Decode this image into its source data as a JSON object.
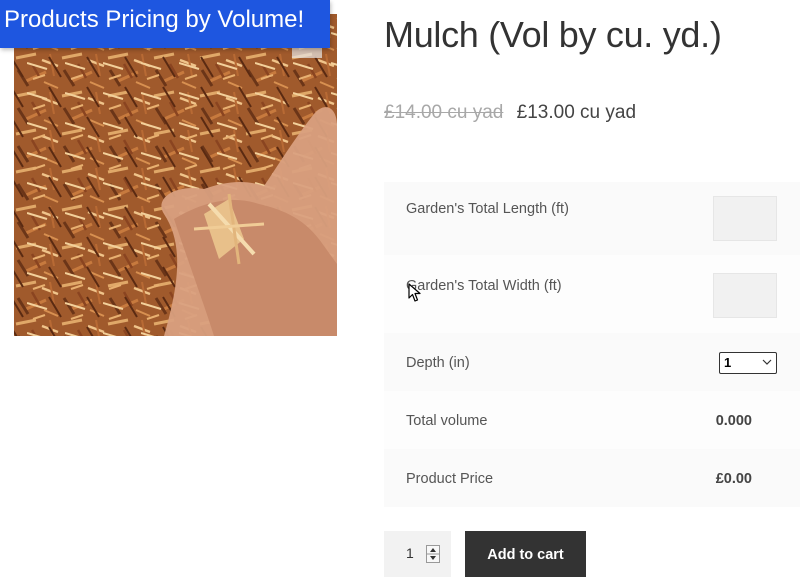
{
  "banner": {
    "text": "Products Pricing by Volume!"
  },
  "product": {
    "title": "Mulch (Vol by cu. yd.)",
    "price_old": "£14.00 cu yad",
    "price_new": "£13.00 cu yad",
    "image_alt": "mulch-in-hand-photo"
  },
  "calculator": {
    "length_label": "Garden's Total Length (ft)",
    "length_value": "",
    "width_label": "Garden's Total Width (ft)",
    "width_value": "",
    "depth_label": "Depth (in)",
    "depth_selected": "1",
    "volume_label": "Total volume",
    "volume_value": "0.000",
    "price_label": "Product Price",
    "price_value": "£0.00"
  },
  "cart": {
    "quantity": "1",
    "add_label": "Add to cart"
  },
  "colors": {
    "banner_bg": "#1e56e0",
    "button_bg": "#333333"
  },
  "icons": {
    "cursor": "mouse-pointer-icon",
    "spinner": "spinner-arrows-icon",
    "dropdown": "chevron-down-icon"
  }
}
